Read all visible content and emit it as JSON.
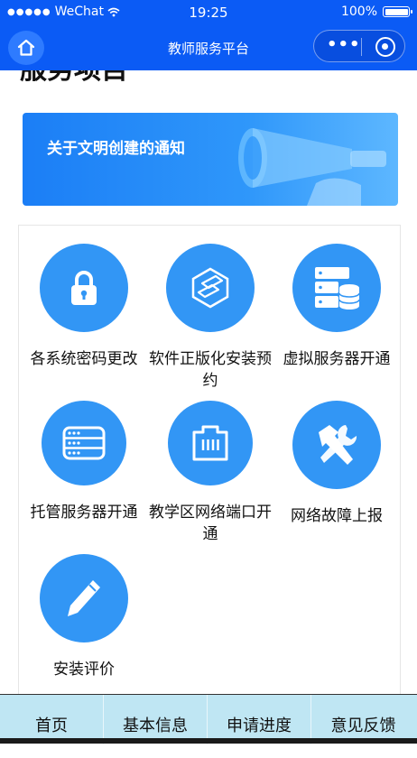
{
  "status_bar": {
    "carrier": "WeChat",
    "time": "19:25",
    "battery": "100%"
  },
  "nav": {
    "title": "教师服务平台"
  },
  "section": {
    "heading": "服务项目"
  },
  "banner": {
    "text": "关于文明创建的通知"
  },
  "services": [
    {
      "label": "各系统密码更改",
      "icon": "lock-icon"
    },
    {
      "label": "软件正版化安装预约",
      "icon": "software-icon"
    },
    {
      "label": "虚拟服务器开通",
      "icon": "server-database-icon"
    },
    {
      "label": "托管服务器开通",
      "icon": "server-rack-icon"
    },
    {
      "label": "教学区网络端口开通",
      "icon": "network-port-icon"
    },
    {
      "label": "网络故障上报",
      "icon": "tools-icon"
    },
    {
      "label": "安装评价",
      "icon": "pencil-icon"
    }
  ],
  "tabs": [
    {
      "label": "首页"
    },
    {
      "label": "基本信息"
    },
    {
      "label": "申请进度"
    },
    {
      "label": "意见反馈"
    }
  ],
  "colors": {
    "brand": "#0b5bf5",
    "icon_circle": "#3296f5",
    "tabbar": "#bfe6f3"
  }
}
